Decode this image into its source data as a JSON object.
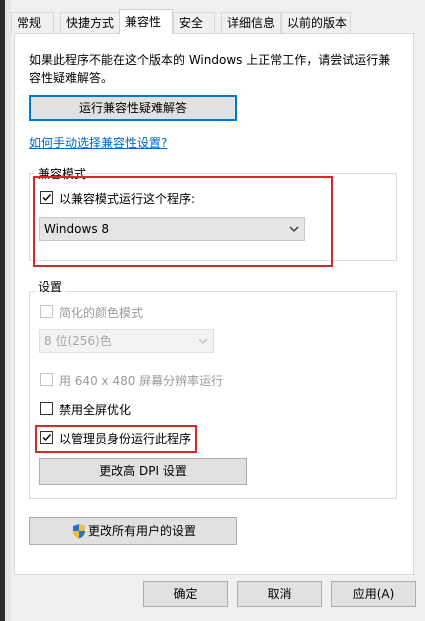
{
  "tabs": [
    "常规",
    "快捷方式",
    "兼容性",
    "安全",
    "详细信息",
    "以前的版本"
  ],
  "active_tab": "兼容性",
  "description": "如果此程序不能在这个版本的 Windows 上正常工作，请尝试运行兼容性疑难解答。",
  "troubleshoot_button": "运行兼容性疑难解答",
  "manual_link": "如何手动选择兼容性设置?",
  "compat_mode": {
    "legend": "兼容模式",
    "checkbox_label": "以兼容模式运行这个程序:",
    "checked": true,
    "selected_os": "Windows 8"
  },
  "settings": {
    "legend": "设置",
    "reduced_color_label": "简化的颜色模式",
    "color_mode_value": "8 位(256)色",
    "resolution_label": "用 640 x 480 屏幕分辨率运行",
    "fullscreen_opt_label": "禁用全屏优化",
    "run_as_admin_label": "以管理员身份运行此程序",
    "run_as_admin_checked": true,
    "dpi_button": "更改高 DPI 设置"
  },
  "all_users_button": "更改所有用户的设置",
  "footer": {
    "ok": "确定",
    "cancel": "取消",
    "apply": "应用(A)"
  },
  "colors": {
    "highlight": "#d9262b",
    "link": "#0066cc",
    "focus_border": "#0078d7"
  }
}
